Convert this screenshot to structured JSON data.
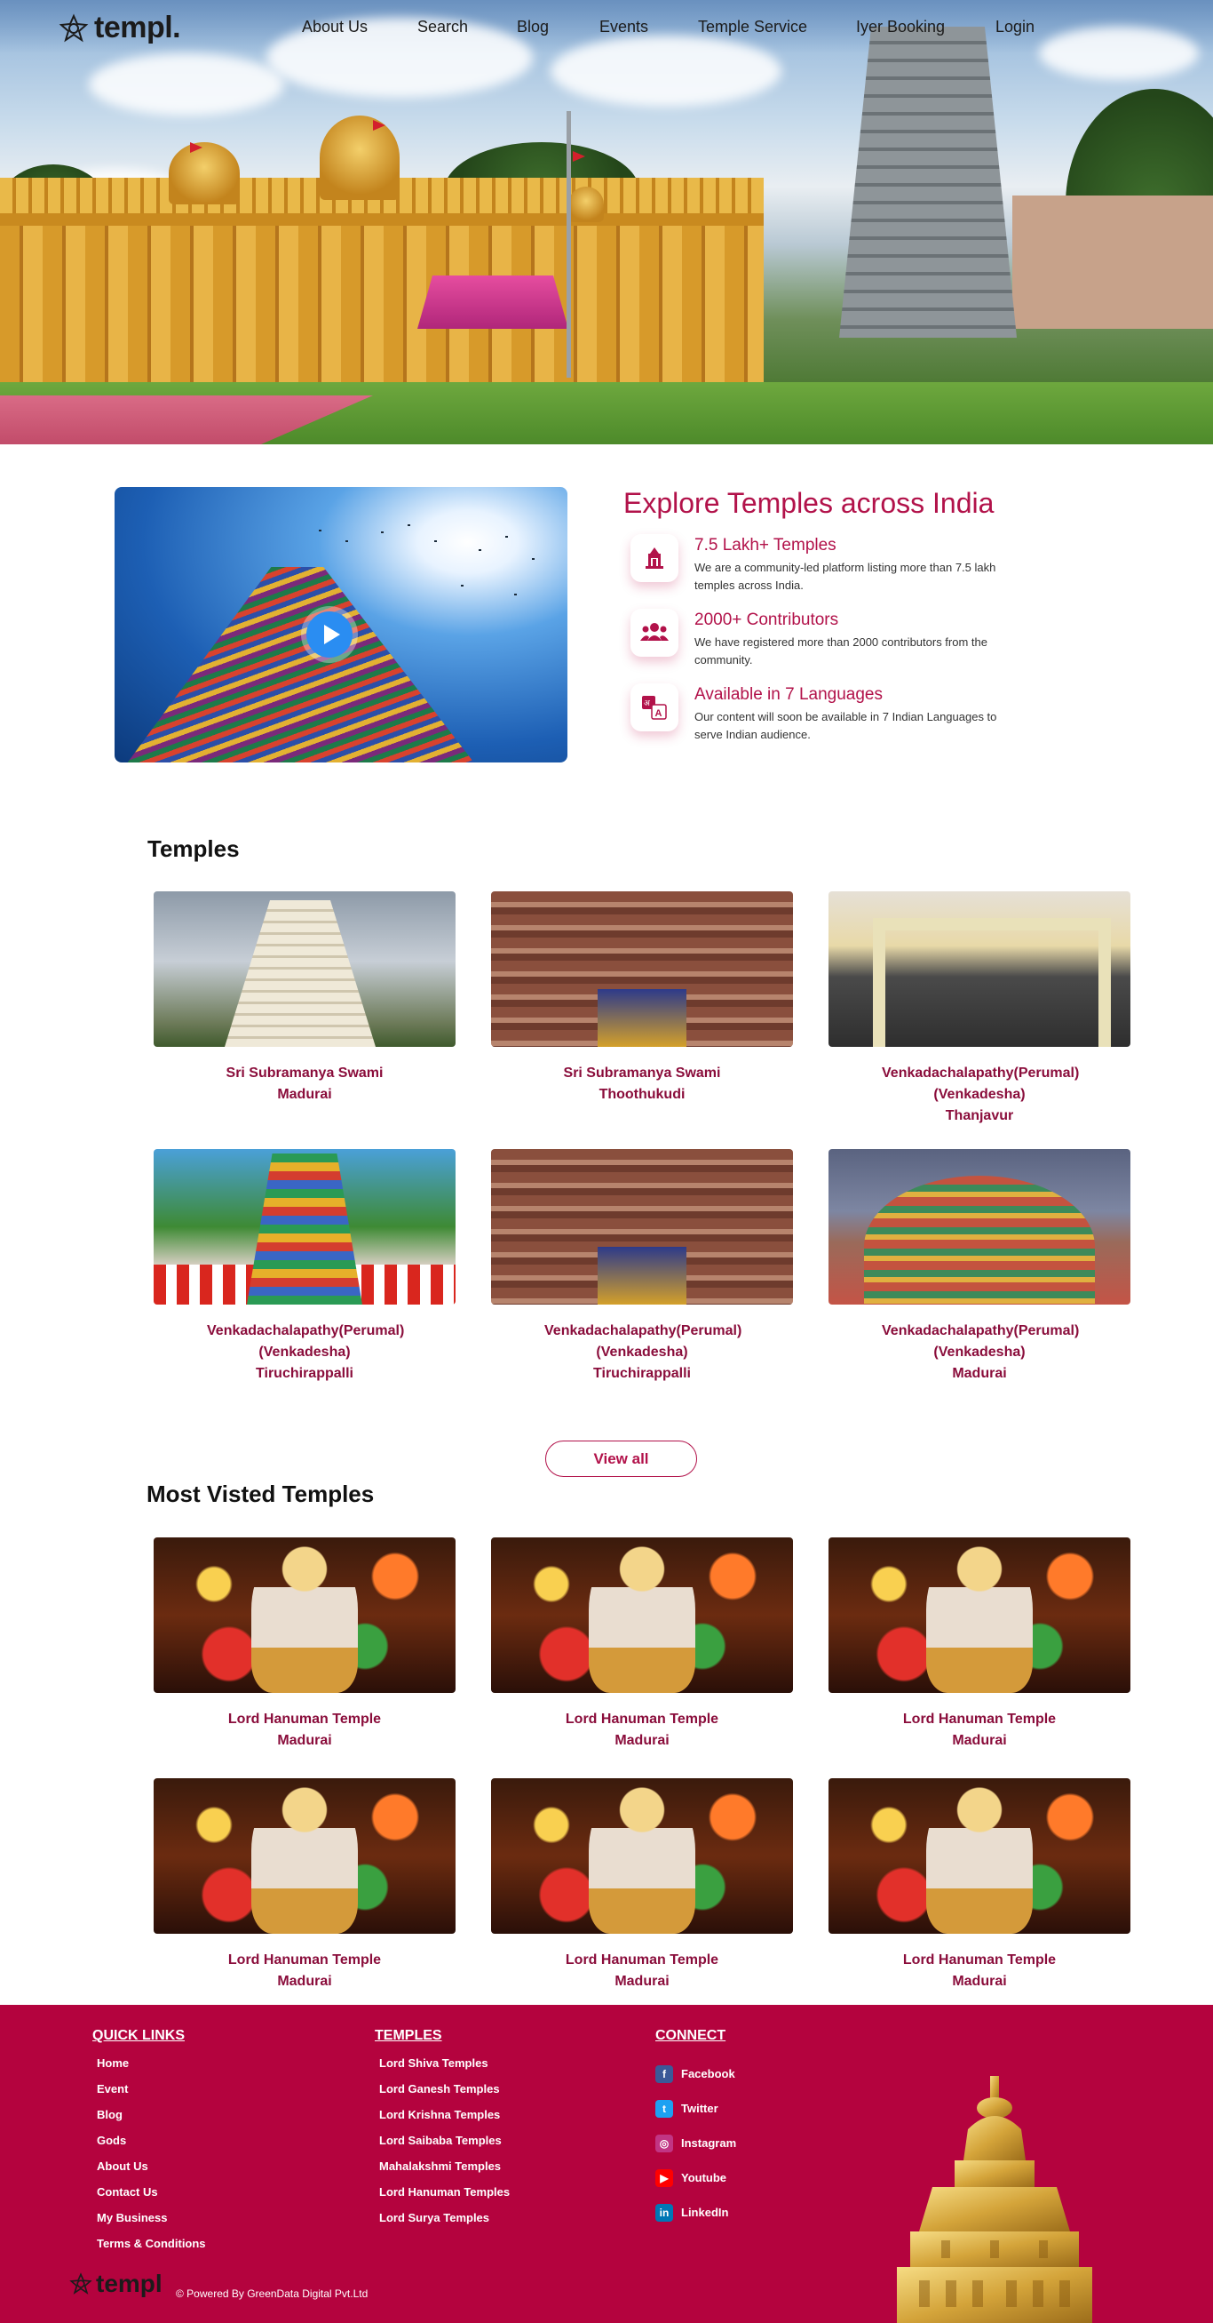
{
  "brand": {
    "name": "templ."
  },
  "nav": {
    "items": [
      {
        "label": "About Us"
      },
      {
        "label": "Search"
      },
      {
        "label": "Blog"
      },
      {
        "label": "Events"
      },
      {
        "label": "Temple Service"
      },
      {
        "label": "Iyer Booking"
      },
      {
        "label": "Login"
      }
    ]
  },
  "explore": {
    "title": "Explore Temples across India",
    "features": [
      {
        "icon": "temple-icon",
        "title": "7.5 Lakh+ Temples",
        "desc": "We are a community-led platform listing more than 7.5 lakh temples across India."
      },
      {
        "icon": "users-icon",
        "title": "2000+ Contributors",
        "desc": "We have registered more than 2000 contributors from the community."
      },
      {
        "icon": "translate-icon",
        "title": "Available in 7 Languages",
        "desc": "Our content will soon be available in 7 Indian Languages to serve Indian audience."
      }
    ]
  },
  "temples": {
    "title": "Temples",
    "items": [
      {
        "name": "Sri Subramanya Swami",
        "city": "Madurai"
      },
      {
        "name": "Sri Subramanya Swami",
        "city": "Thoothukudi"
      },
      {
        "name": "Venkadachalapathy(Perumal) (Venkadesha)",
        "city": "Thanjavur"
      },
      {
        "name": "Venkadachalapathy(Perumal) (Venkadesha)",
        "city": "Tiruchirappalli"
      },
      {
        "name": "Venkadachalapathy(Perumal) (Venkadesha)",
        "city": "Tiruchirappalli"
      },
      {
        "name": "Venkadachalapathy(Perumal) (Venkadesha)",
        "city": "Madurai"
      }
    ],
    "view_all": "View all"
  },
  "most_visited": {
    "title": "Most Visted Temples",
    "items": [
      {
        "name": "Lord Hanuman Temple",
        "city": "Madurai"
      },
      {
        "name": "Lord Hanuman Temple",
        "city": "Madurai"
      },
      {
        "name": "Lord Hanuman Temple",
        "city": "Madurai"
      },
      {
        "name": "Lord Hanuman Temple",
        "city": "Madurai"
      },
      {
        "name": "Lord Hanuman Temple",
        "city": "Madurai"
      },
      {
        "name": "Lord Hanuman Temple",
        "city": "Madurai"
      }
    ]
  },
  "footer": {
    "quick_links": {
      "title": "QUICK LINKS",
      "items": [
        "Home",
        "Event",
        "Blog",
        "Gods",
        "About Us",
        "Contact Us",
        "My Business",
        "Terms & Conditions"
      ]
    },
    "temples": {
      "title": "TEMPLES",
      "items": [
        "Lord Shiva Temples",
        "Lord Ganesh Temples",
        "Lord Krishna Temples",
        "Lord Saibaba Temples",
        "Mahalakshmi Temples",
        "Lord Hanuman Temples",
        "Lord Surya Temples"
      ]
    },
    "connect": {
      "title": "CONNECT",
      "items": [
        {
          "label": "Facebook",
          "icon": "facebook-icon",
          "color": "#3b5998"
        },
        {
          "label": "Twitter",
          "icon": "twitter-icon",
          "color": "#1da1f2"
        },
        {
          "label": "Instagram",
          "icon": "instagram-icon",
          "color": "#c13584"
        },
        {
          "label": "Youtube",
          "icon": "youtube-icon",
          "color": "#ff0000"
        },
        {
          "label": "LinkedIn",
          "icon": "linkedin-icon",
          "color": "#0077b5"
        }
      ]
    },
    "logo_text": "templ",
    "powered_by": "© Powered By GreenData Digital Pvt.Ltd"
  },
  "colors": {
    "accent": "#b2124a",
    "footer_bg": "#b4033e",
    "card_text": "#8a0d3b",
    "play": "#2a8df2"
  }
}
